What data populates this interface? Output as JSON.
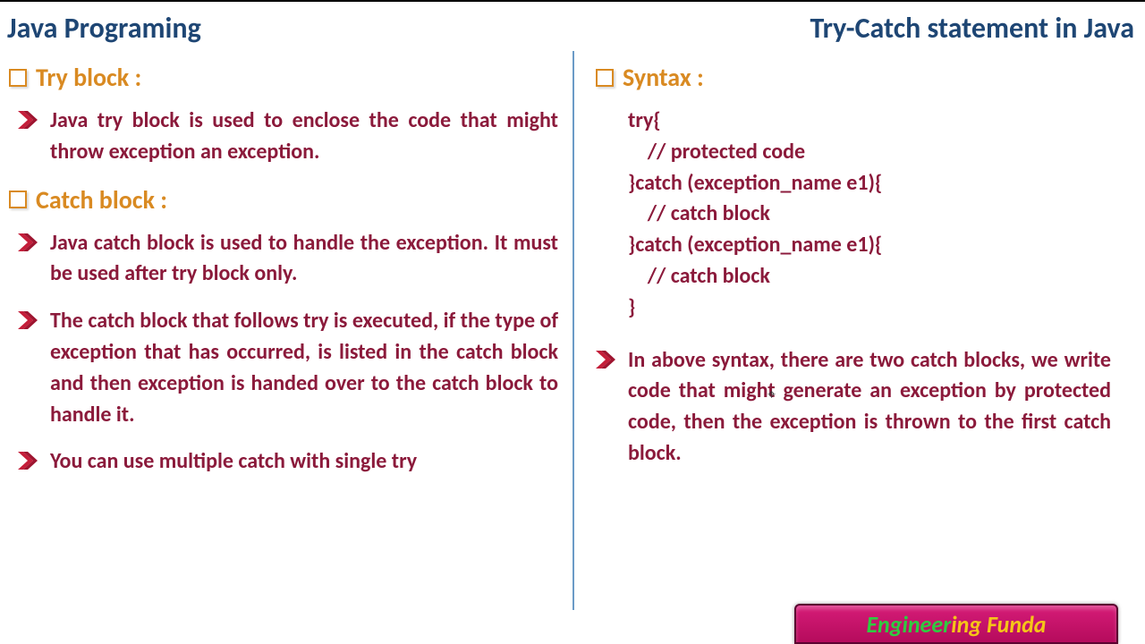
{
  "header": {
    "left": "Java Programing",
    "right": "Try-Catch statement in Java"
  },
  "left": {
    "section1_title": "Try block :",
    "section1_points": [
      "Java try block is used to enclose the code that might throw exception an exception."
    ],
    "section2_title": "Catch block :",
    "section2_points": [
      "Java catch block is used to handle the exception. It must be used after try block only.",
      "The catch block that follows try is executed, if the type of exception that has occurred, is listed in the catch block and then exception is handed over to the catch block to handle it.",
      "You can use multiple catch with single try"
    ]
  },
  "right": {
    "section_title": "Syntax :",
    "code": "try{\n    // protected code\n}catch (exception_name e1){\n    // catch block\n}catch (exception_name e1){\n    // catch block\n}",
    "points": [
      "In above syntax, there are two catch blocks, we write code that might generate an exception by protected code, then the exception is thrown to the first catch block."
    ]
  },
  "brand": {
    "part1": "Engineer",
    "part2": "ing Funda"
  }
}
